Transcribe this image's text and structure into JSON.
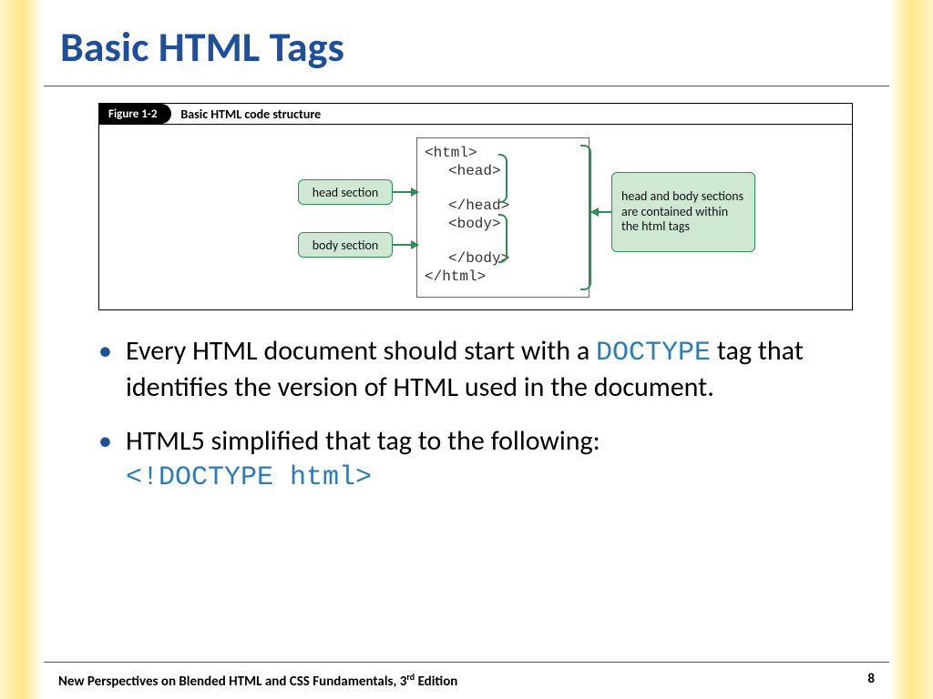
{
  "title": "Basic HTML Tags",
  "figure": {
    "label": "Figure 1-2",
    "caption": "Basic HTML code structure",
    "code": {
      "l1": "<html>",
      "l2": "<head>",
      "l3": "</head>",
      "l4": "<body>",
      "l5": "</body>",
      "l6": "</html>"
    },
    "callouts": {
      "head": "head section",
      "body": "body section",
      "rhs": "head and body sections are contained within the html tags"
    }
  },
  "bullets": {
    "b1a": "Every HTML document should start with a ",
    "b1code": "DOCTYPE",
    "b1b": " tag that identifies the version of HTML used in the document.",
    "b2a": "HTML5 simplified that tag to the following: ",
    "b2code": "<!DOCTYPE html>"
  },
  "footer": {
    "left_a": "New Perspectives on Blended HTML and CSS Fundamentals, 3",
    "left_sup": "rd",
    "left_b": " Edition",
    "page": "8"
  }
}
